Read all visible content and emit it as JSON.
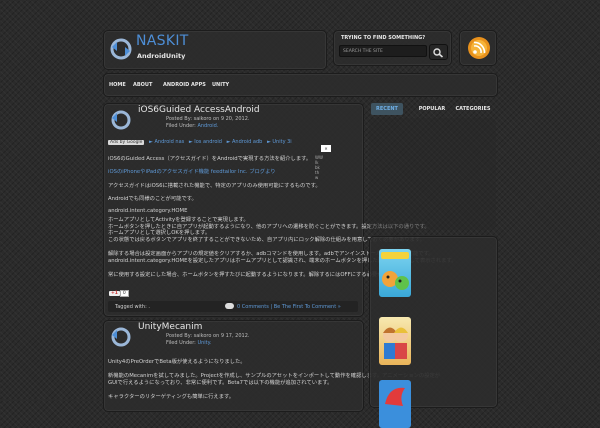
{
  "header": {
    "title": "NASKIT",
    "subtitle": "AndroidUnity"
  },
  "search": {
    "label": "TRYING TO FIND SOMETHING?",
    "placeholder": "SEARCH THE SITE"
  },
  "nav": {
    "items": [
      "HOME",
      "ABOUT",
      "ANDROID APPS",
      "UNITY"
    ]
  },
  "posts": [
    {
      "title": "iOS6Guided AccessAndroid",
      "meta_posted": "Posted By: saikoro on 9 20, 2012.",
      "meta_filed_prefix": "Filed Under:",
      "meta_filed_link": "Android.",
      "ads_label": "Ads by Google",
      "ad_links": [
        "► Android nas",
        "► Ios android",
        "► Android adb",
        "► Unity 3i"
      ],
      "ad_close": "✕",
      "ad_side": [
        "WW",
        "lk",
        "bk",
        "th",
        "w"
      ],
      "lines": [
        "iOS6のGuided Access（アクセスガイド）をAndroidで実現する方法を紹介します。",
        "iOSのiPhoneやiPadのアクセスガイド機能 feedtailor Inc. ブログより",
        "アクセスガイドはiOS6に搭載された機能で、特定のアプリのみ使用可能にするものです。",
        "Androidでも同様のことが可能です。",
        "android.intent.category.HOME",
        "ホームアプリとしてActivityを登録することで実現します。",
        "ホームボタンを押したときに自アプリが起動するようになり、他のアプリへの遷移を防ぐことができます。設定方法は以下の通りです。",
        "ホームアプリとして選択しOKを押します。",
        "この状態では戻るボタンでアプリを終了することができないため、自アプリ内にロック解除の仕組みを用意しておく必要があります。",
        "解除する場合は設定画面からアプリの規定値をクリアするか、adbコマンドを使用します。adbでアンインストールすることも可能です。",
        "android.intent.category.HOMEを設定したアプリはホームアプリとして認識され、端末のホームボタンを押した際に選択肢として表示されます。",
        "常に使用する設定にした場合、ホームボタンを押すたびに起動するようになります。解除するにはOFFにする必要があります。"
      ],
      "gplus": "+1",
      "gplus_count": "0",
      "tagged": "Tagged with: .",
      "comments": "0 Comments | Be The First To Comment »"
    },
    {
      "title": "UnityMecanim",
      "meta_posted": "Posted By: saikoro on 9 17, 2012.",
      "meta_filed_prefix": "Filed Under:",
      "meta_filed_link": "Unity.",
      "lines": [
        "Unity4のPreOrderでBeta版が使えるようになりました。",
        "新機能のMecanimを試してみました。Projectを作成し、サンプルのアセットをインポートして動作を確認します。アニメーションの設定が",
        "GUIで行えるようになっており、非常に便利です。Beta7では以下の機能が追加されています。",
        "キャラクターのリターゲティングも簡単に行えます。"
      ]
    }
  ],
  "sidebar": {
    "tabs": [
      "RECENT",
      "POPULAR",
      "CATEGORIES"
    ]
  },
  "colors": {
    "accent": "#4d8ed6",
    "link": "#5f9ad8",
    "rss": "#f0a020"
  },
  "icons": {
    "logo": "arrows-refresh-icon",
    "search": "magnifier-icon",
    "rss": "rss-feed-icon"
  }
}
